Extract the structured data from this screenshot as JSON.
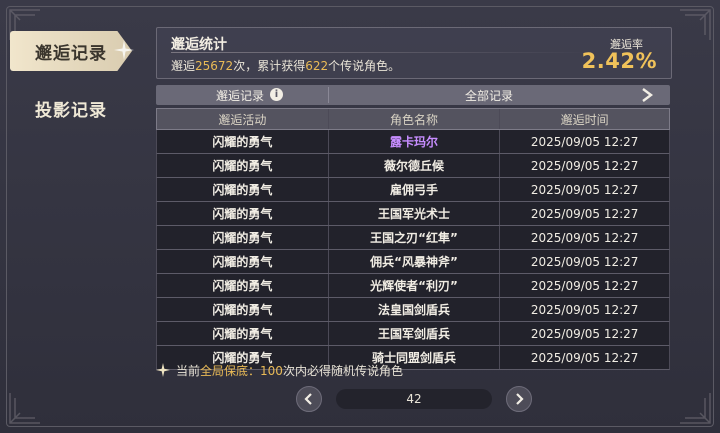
{
  "nav": {
    "tabs": [
      {
        "label": "邂逅记录",
        "active": true
      },
      {
        "label": "投影记录",
        "active": false
      }
    ]
  },
  "stats": {
    "title": "邂逅统计",
    "prefix": "邂逅",
    "total": "25672",
    "middle": "次，累计获得",
    "legend_count": "622",
    "suffix": "个传说角色。",
    "rate_label": "邂逅率",
    "rate_value": "2.42%"
  },
  "filter": {
    "label": "邂逅记录",
    "value": "全部记录"
  },
  "table": {
    "headers": [
      "邂逅活动",
      "角色名称",
      "邂逅时间"
    ],
    "rows": [
      {
        "activity": "闪耀的勇气",
        "name": "露卡玛尔",
        "time": "2025/09/05 12:27",
        "highlight": true
      },
      {
        "activity": "闪耀的勇气",
        "name": "薇尔德丘候",
        "time": "2025/09/05 12:27"
      },
      {
        "activity": "闪耀的勇气",
        "name": "雇佣弓手",
        "time": "2025/09/05 12:27"
      },
      {
        "activity": "闪耀的勇气",
        "name": "王国军光术士",
        "time": "2025/09/05 12:27"
      },
      {
        "activity": "闪耀的勇气",
        "name": "王国之刃“红隼”",
        "time": "2025/09/05 12:27"
      },
      {
        "activity": "闪耀的勇气",
        "name": "佣兵“风暴神斧”",
        "time": "2025/09/05 12:27"
      },
      {
        "activity": "闪耀的勇气",
        "name": "光辉使者“利刃”",
        "time": "2025/09/05 12:27"
      },
      {
        "activity": "闪耀的勇气",
        "name": "法皇国剑盾兵",
        "time": "2025/09/05 12:27"
      },
      {
        "activity": "闪耀的勇气",
        "name": "王国军剑盾兵",
        "time": "2025/09/05 12:27"
      },
      {
        "activity": "闪耀的勇气",
        "name": "骑士同盟剑盾兵",
        "time": "2025/09/05 12:27"
      }
    ]
  },
  "pity": {
    "prefix": "当前",
    "highlight": "全局保底：",
    "count": "100",
    "suffix": "次内必得随机传说角色"
  },
  "pager": {
    "page": "42"
  },
  "colors": {
    "accent": "#e9ba56",
    "legend_name": "#c78dff"
  },
  "icons": {
    "info": "info-icon",
    "arrow": "chevron-right-icon",
    "prev": "chevron-left-icon",
    "next": "chevron-right-icon",
    "pity": "sparkle-icon"
  }
}
